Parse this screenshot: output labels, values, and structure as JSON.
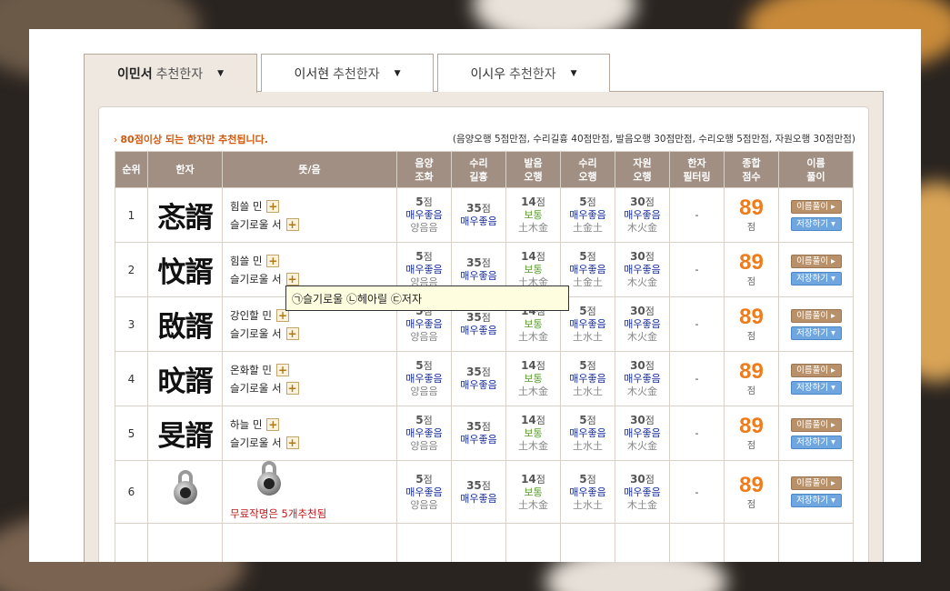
{
  "tabs": [
    {
      "name": "이민서",
      "suffix": "추천한자"
    },
    {
      "name": "이서현",
      "suffix": "추천한자"
    },
    {
      "name": "이시우",
      "suffix": "추천한자"
    }
  ],
  "caret": "▼",
  "notice": "80점이상 되는 한자만 추천됩니다.",
  "notice_bullet": "›",
  "legend": "(음양오행 5점만점, 수리길흉 40점만점, 발음오행 30점만점, 수리오행 5점만점, 자원오행 30점만점)",
  "headers": [
    "순위",
    "한자",
    "뜻/음",
    "음양\n조화",
    "수리\n길흉",
    "발음\n오행",
    "수리\n오행",
    "자원\n오행",
    "한자\n필터링",
    "종합\n점수",
    "이름\n풀이"
  ],
  "plus_label": "+",
  "unit": "점",
  "buttons": {
    "interpret": "이름풀이 ▸",
    "save": "저장하기 ▾"
  },
  "free_note": "무료작명은 5개추천됨",
  "tooltip": "㉠슬기로울 ㉡헤아릴 ㉢저자",
  "rows": [
    {
      "rank": "1",
      "hanja": "忞諝",
      "m1": "힘쓸 민",
      "m2": "슬기로울 서",
      "yy": {
        "n": "5",
        "g": "매우좋음",
        "e": "양음음"
      },
      "sr": {
        "n": "35",
        "g": "매우좋음"
      },
      "bo": {
        "n": "14",
        "g": "보통",
        "e": "土木金"
      },
      "so": {
        "n": "5",
        "g": "매우좋음",
        "e": "土金土"
      },
      "jo": {
        "n": "30",
        "g": "매우좋음",
        "e": "木火金"
      },
      "filter": "-",
      "total": "89"
    },
    {
      "rank": "2",
      "hanja": "忟諝",
      "m1": "힘쓸 민",
      "m2": "슬기로울 서",
      "yy": {
        "n": "5",
        "g": "매우좋음",
        "e": "양음음"
      },
      "sr": {
        "n": "35",
        "g": "매우좋음"
      },
      "bo": {
        "n": "14",
        "g": "보통",
        "e": "土木金"
      },
      "so": {
        "n": "5",
        "g": "매우좋음",
        "e": "土金土"
      },
      "jo": {
        "n": "30",
        "g": "매우좋음",
        "e": "木火金"
      },
      "filter": "-",
      "total": "89"
    },
    {
      "rank": "3",
      "hanja": "敃諝",
      "m1": "강인할 민",
      "m2": "슬기로울 서",
      "yy": {
        "n": "5",
        "g": "매우좋음",
        "e": "양음음"
      },
      "sr": {
        "n": "35",
        "g": "매우좋음"
      },
      "bo": {
        "n": "14",
        "g": "보통",
        "e": "土木金"
      },
      "so": {
        "n": "5",
        "g": "매우좋음",
        "e": "土水土"
      },
      "jo": {
        "n": "30",
        "g": "매우좋음",
        "e": "木火金"
      },
      "filter": "-",
      "total": "89"
    },
    {
      "rank": "4",
      "hanja": "旼諝",
      "m1": "온화할 민",
      "m2": "슬기로울 서",
      "yy": {
        "n": "5",
        "g": "매우좋음",
        "e": "양음음"
      },
      "sr": {
        "n": "35",
        "g": "매우좋음"
      },
      "bo": {
        "n": "14",
        "g": "보통",
        "e": "土木金"
      },
      "so": {
        "n": "5",
        "g": "매우좋음",
        "e": "土水土"
      },
      "jo": {
        "n": "30",
        "g": "매우좋음",
        "e": "木火金"
      },
      "filter": "-",
      "total": "89"
    },
    {
      "rank": "5",
      "hanja": "旻諝",
      "m1": "하늘 민",
      "m2": "슬기로울 서",
      "yy": {
        "n": "5",
        "g": "매우좋음",
        "e": "양음음"
      },
      "sr": {
        "n": "35",
        "g": "매우좋음"
      },
      "bo": {
        "n": "14",
        "g": "보통",
        "e": "土木金"
      },
      "so": {
        "n": "5",
        "g": "매우좋음",
        "e": "土水土"
      },
      "jo": {
        "n": "30",
        "g": "매우좋음",
        "e": "木火金"
      },
      "filter": "-",
      "total": "89"
    },
    {
      "rank": "6",
      "hanja": "",
      "m1": "",
      "m2": "",
      "yy": {
        "n": "5",
        "g": "매우좋음",
        "e": "양음음"
      },
      "sr": {
        "n": "35",
        "g": "매우좋음"
      },
      "bo": {
        "n": "14",
        "g": "보통",
        "e": "土木金"
      },
      "so": {
        "n": "5",
        "g": "매우좋음",
        "e": "土水土"
      },
      "jo": {
        "n": "30",
        "g": "매우좋음",
        "e": "木土金"
      },
      "filter": "-",
      "total": "89"
    }
  ]
}
